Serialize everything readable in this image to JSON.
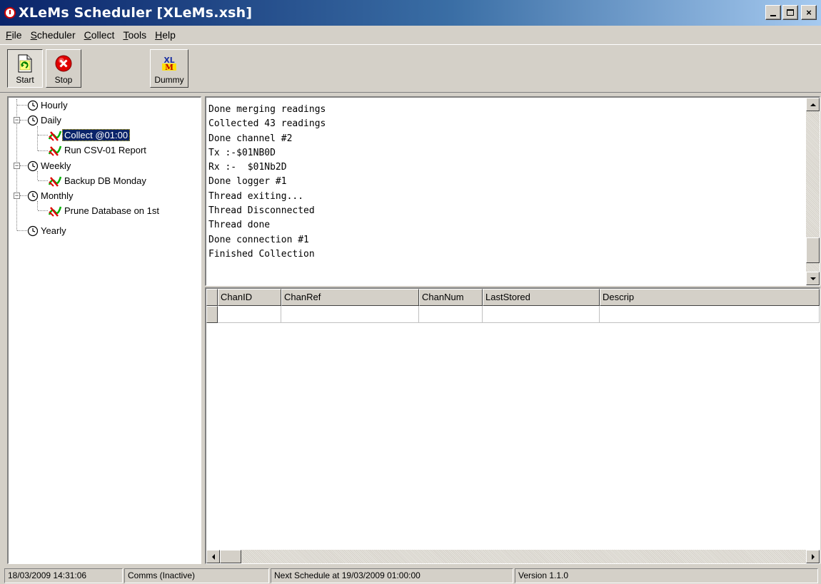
{
  "window": {
    "title": "XLeMs Scheduler [XLeMs.xsh]",
    "minimize_label": "_",
    "close_label": "×"
  },
  "menu": {
    "items": [
      {
        "label": "File",
        "mnemonic": "F",
        "rest": "ile"
      },
      {
        "label": "Scheduler",
        "mnemonic": "S",
        "rest": "cheduler"
      },
      {
        "label": "Collect",
        "mnemonic": "C",
        "rest": "ollect"
      },
      {
        "label": "Tools",
        "mnemonic": "T",
        "rest": "ools"
      },
      {
        "label": "Help",
        "mnemonic": "H",
        "rest": "elp"
      }
    ]
  },
  "toolbar": {
    "start_label": "Start",
    "stop_label": "Stop",
    "dummy_label": "Dummy",
    "dummy_logo_top": "XL",
    "dummy_logo_mid": "M"
  },
  "tree": {
    "nodes": [
      {
        "label": "Hourly",
        "icon": "clock-icon"
      },
      {
        "label": "Daily",
        "icon": "clock-icon",
        "expanded": true
      },
      {
        "label": "Collect @01:00",
        "icon": "task-icon",
        "selected": true
      },
      {
        "label": "Run CSV-01 Report",
        "icon": "task-icon"
      },
      {
        "label": "Weekly",
        "icon": "clock-icon",
        "expanded": true
      },
      {
        "label": "Backup DB Monday",
        "icon": "task-icon"
      },
      {
        "label": "Monthly",
        "icon": "clock-icon",
        "expanded": true
      },
      {
        "label": "Prune Database on 1st",
        "icon": "task-icon"
      },
      {
        "label": "Yearly",
        "icon": "clock-icon"
      }
    ]
  },
  "log": {
    "lines": [
      "Done merging readings",
      "Collected 43 readings",
      "Done channel #2",
      "Tx :-$01NB0D",
      "Rx :-  $01Nb2D",
      "Done logger #1",
      "Thread exiting...",
      "Thread Disconnected",
      "Thread done",
      "Done connection #1",
      "Finished Collection"
    ]
  },
  "grid": {
    "columns": [
      "ChanID",
      "ChanRef",
      "ChanNum",
      "LastStored",
      "Descrip"
    ]
  },
  "status": {
    "datetime": "18/03/2009 14:31:06",
    "comms": "Comms (Inactive)",
    "next_schedule": "Next Schedule at 19/03/2009 01:00:00",
    "version": "Version 1.1.0"
  },
  "colors": {
    "title_start": "#0a246a",
    "title_end": "#a6caf0",
    "selection": "#0a246a",
    "face": "#d4d0c8"
  }
}
